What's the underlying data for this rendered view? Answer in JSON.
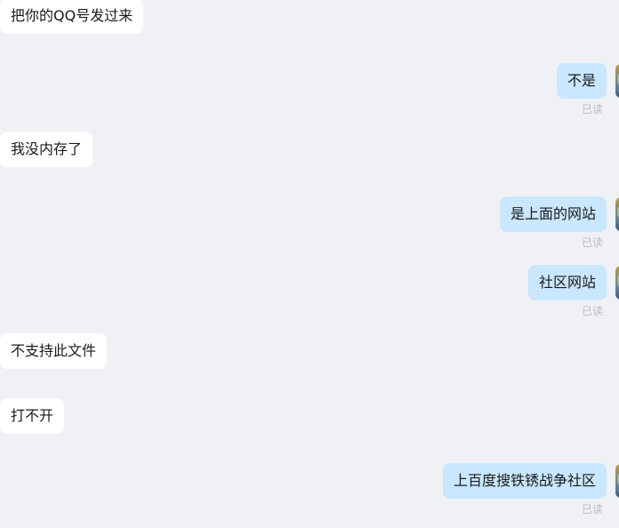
{
  "messages": [
    {
      "side": "in",
      "text": "把你的QQ号发过来"
    },
    {
      "side": "out",
      "text": "不是",
      "status": "已读"
    },
    {
      "side": "in",
      "text": "我没内存了"
    },
    {
      "side": "out",
      "text": "是上面的网站",
      "status": "已读"
    },
    {
      "side": "out",
      "text": "社区网站",
      "status": "已读"
    },
    {
      "side": "in",
      "text": "不支持此文件"
    },
    {
      "side": "in",
      "text": "打不开"
    },
    {
      "side": "out",
      "text": "上百度搜铁锈战争社区",
      "status": "已读"
    }
  ]
}
